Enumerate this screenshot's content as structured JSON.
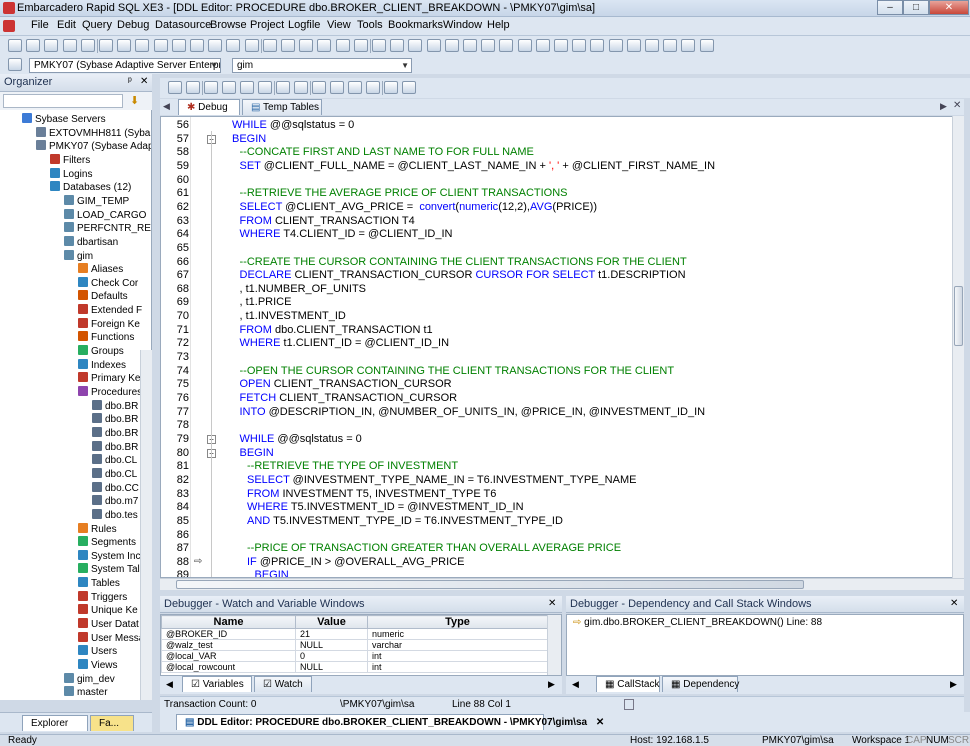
{
  "window": {
    "title": "Embarcadero Rapid SQL XE3 - [DDL Editor: PROCEDURE dbo.BROKER_CLIENT_BREAKDOWN - \\PMKY07\\gim\\sa]"
  },
  "menu": [
    "File",
    "Edit",
    "Query",
    "Debug",
    "Datasource",
    "Browse",
    "Project",
    "Logfile",
    "View",
    "Tools",
    "Bookmarks",
    "Window",
    "Help"
  ],
  "datasource_bar": {
    "server": "PMKY07 (Sybase Adaptive Server Enterpris",
    "database": "gim"
  },
  "organizer": {
    "title": "Organizer",
    "pin": "ᵖ",
    "items": [
      {
        "label": "Sybase Servers",
        "indent": 1,
        "color": "#3d7bd6"
      },
      {
        "label": "EXTOVMHH811 (Syba",
        "indent": 2,
        "color": "#6a7f99"
      },
      {
        "label": "PMKY07 (Sybase Adap",
        "indent": 2,
        "color": "#6a7f99"
      },
      {
        "label": "Filters",
        "indent": 3,
        "color": "#c0392b"
      },
      {
        "label": "Logins",
        "indent": 3,
        "color": "#2e86c1"
      },
      {
        "label": "Databases (12)",
        "indent": 3,
        "color": "#2e86c1"
      },
      {
        "label": "GIM_TEMP",
        "indent": 4,
        "color": "#5d8aa8"
      },
      {
        "label": "LOAD_CARGO",
        "indent": 4,
        "color": "#5d8aa8"
      },
      {
        "label": "PERFCNTR_RE",
        "indent": 4,
        "color": "#5d8aa8"
      },
      {
        "label": "dbartisan",
        "indent": 4,
        "color": "#5d8aa8"
      },
      {
        "label": "gim",
        "indent": 4,
        "color": "#5d8aa8"
      },
      {
        "label": "Aliases",
        "indent": 5,
        "color": "#e67e22"
      },
      {
        "label": "Check Cor",
        "indent": 5,
        "color": "#2e86c1"
      },
      {
        "label": "Defaults",
        "indent": 5,
        "color": "#d35400"
      },
      {
        "label": "Extended F",
        "indent": 5,
        "color": "#c0392b"
      },
      {
        "label": "Foreign Ke",
        "indent": 5,
        "color": "#c0392b"
      },
      {
        "label": "Functions",
        "indent": 5,
        "color": "#d35400"
      },
      {
        "label": "Groups",
        "indent": 5,
        "color": "#27ae60"
      },
      {
        "label": "Indexes",
        "indent": 5,
        "color": "#2e86c1"
      },
      {
        "label": "Primary Ke",
        "indent": 5,
        "color": "#c0392b"
      },
      {
        "label": "Procedures",
        "indent": 5,
        "color": "#8e44ad"
      },
      {
        "label": "dbo.BR",
        "indent": 6,
        "color": "#5b6f88"
      },
      {
        "label": "dbo.BR",
        "indent": 6,
        "color": "#5b6f88"
      },
      {
        "label": "dbo.BR",
        "indent": 6,
        "color": "#5b6f88"
      },
      {
        "label": "dbo.BR",
        "indent": 6,
        "color": "#5b6f88"
      },
      {
        "label": "dbo.CL",
        "indent": 6,
        "color": "#5b6f88"
      },
      {
        "label": "dbo.CL",
        "indent": 6,
        "color": "#5b6f88"
      },
      {
        "label": "dbo.CC",
        "indent": 6,
        "color": "#5b6f88"
      },
      {
        "label": "dbo.m7",
        "indent": 6,
        "color": "#5b6f88"
      },
      {
        "label": "dbo.tes",
        "indent": 6,
        "color": "#5b6f88"
      },
      {
        "label": "Rules",
        "indent": 5,
        "color": "#e67e22"
      },
      {
        "label": "Segments",
        "indent": 5,
        "color": "#27ae60"
      },
      {
        "label": "System Inc",
        "indent": 5,
        "color": "#2e86c1"
      },
      {
        "label": "System Tal",
        "indent": 5,
        "color": "#27ae60"
      },
      {
        "label": "Tables",
        "indent": 5,
        "color": "#2e86c1"
      },
      {
        "label": "Triggers",
        "indent": 5,
        "color": "#c0392b"
      },
      {
        "label": "Unique Ke",
        "indent": 5,
        "color": "#c0392b"
      },
      {
        "label": "User Datat",
        "indent": 5,
        "color": "#c0392b"
      },
      {
        "label": "User Messa",
        "indent": 5,
        "color": "#c0392b"
      },
      {
        "label": "Users",
        "indent": 5,
        "color": "#2e86c1"
      },
      {
        "label": "Views",
        "indent": 5,
        "color": "#2e86c1"
      },
      {
        "label": "gim_dev",
        "indent": 4,
        "color": "#5d8aa8"
      },
      {
        "label": "master",
        "indent": 4,
        "color": "#5d8aa8"
      }
    ],
    "bottom_tabs": [
      "Explorer",
      "Fa..."
    ]
  },
  "editor_tabs": [
    "Debug",
    "Temp Tables"
  ],
  "code_lines": [
    {
      "n": "56",
      "i": 4,
      "t": [
        [
          "kw",
          "WHILE "
        ],
        [
          "",
          "@@sqlstatus = 0"
        ]
      ]
    },
    {
      "n": "57",
      "i": 4,
      "t": [
        [
          "kw",
          "BEGIN"
        ]
      ]
    },
    {
      "n": "58",
      "i": 6,
      "t": [
        [
          "cm",
          "--CONCATE FIRST AND LAST NAME TO FOR FULL NAME"
        ]
      ]
    },
    {
      "n": "59",
      "i": 6,
      "t": [
        [
          "kw",
          "SET "
        ],
        [
          "",
          "@CLIENT_FULL_NAME = @CLIENT_LAST_NAME_IN + "
        ],
        [
          "st",
          "', '"
        ],
        [
          "",
          " + @CLIENT_FIRST_NAME_IN"
        ]
      ]
    },
    {
      "n": "60",
      "i": 0,
      "t": []
    },
    {
      "n": "61",
      "i": 6,
      "t": [
        [
          "cm",
          "--RETRIEVE THE AVERAGE PRICE OF CLIENT TRANSACTIONS"
        ]
      ]
    },
    {
      "n": "62",
      "i": 6,
      "t": [
        [
          "kw",
          "SELECT "
        ],
        [
          "",
          "@CLIENT_AVG_PRICE =  "
        ],
        [
          "fn",
          "convert"
        ],
        [
          "",
          "("
        ],
        [
          "fn",
          "numeric"
        ],
        [
          "",
          "(12,2),"
        ],
        [
          "fn",
          "AVG"
        ],
        [
          "",
          "(PRICE))"
        ]
      ]
    },
    {
      "n": "63",
      "i": 6,
      "t": [
        [
          "kw",
          "FROM "
        ],
        [
          "",
          "CLIENT_TRANSACTION T4"
        ]
      ]
    },
    {
      "n": "64",
      "i": 6,
      "t": [
        [
          "kw",
          "WHERE "
        ],
        [
          "",
          "T4.CLIENT_ID = @CLIENT_ID_IN"
        ]
      ]
    },
    {
      "n": "65",
      "i": 0,
      "t": []
    },
    {
      "n": "66",
      "i": 6,
      "t": [
        [
          "cm",
          "--CREATE THE CURSOR CONTAINING THE CLIENT TRANSACTIONS FOR THE CLIENT"
        ]
      ]
    },
    {
      "n": "67",
      "i": 6,
      "t": [
        [
          "kw",
          "DECLARE "
        ],
        [
          "",
          "CLIENT_TRANSACTION_CURSOR "
        ],
        [
          "kw",
          "CURSOR FOR SELECT "
        ],
        [
          "",
          "t1.DESCRIPTION"
        ]
      ]
    },
    {
      "n": "68",
      "i": 6,
      "t": [
        [
          "",
          ", t1.NUMBER_OF_UNITS"
        ]
      ]
    },
    {
      "n": "69",
      "i": 6,
      "t": [
        [
          "",
          ", t1.PRICE"
        ]
      ]
    },
    {
      "n": "70",
      "i": 6,
      "t": [
        [
          "",
          ", t1.INVESTMENT_ID"
        ]
      ]
    },
    {
      "n": "71",
      "i": 6,
      "t": [
        [
          "kw",
          "FROM "
        ],
        [
          "",
          "dbo.CLIENT_TRANSACTION t1"
        ]
      ]
    },
    {
      "n": "72",
      "i": 6,
      "t": [
        [
          "kw",
          "WHERE "
        ],
        [
          "",
          "t1.CLIENT_ID = @CLIENT_ID_IN"
        ]
      ]
    },
    {
      "n": "73",
      "i": 0,
      "t": []
    },
    {
      "n": "74",
      "i": 6,
      "t": [
        [
          "cm",
          "--OPEN THE CURSOR CONTAINING THE CLIENT TRANSACTIONS FOR THE CLIENT"
        ]
      ]
    },
    {
      "n": "75",
      "i": 6,
      "t": [
        [
          "kw",
          "OPEN "
        ],
        [
          "",
          "CLIENT_TRANSACTION_CURSOR"
        ]
      ]
    },
    {
      "n": "76",
      "i": 6,
      "t": [
        [
          "kw",
          "FETCH "
        ],
        [
          "",
          "CLIENT_TRANSACTION_CURSOR"
        ]
      ]
    },
    {
      "n": "77",
      "i": 6,
      "t": [
        [
          "kw",
          "INTO "
        ],
        [
          "",
          "@DESCRIPTION_IN, @NUMBER_OF_UNITS_IN, @PRICE_IN, @INVESTMENT_ID_IN"
        ]
      ]
    },
    {
      "n": "78",
      "i": 0,
      "t": []
    },
    {
      "n": "79",
      "i": 6,
      "t": [
        [
          "kw",
          "WHILE "
        ],
        [
          "",
          "@@sqlstatus = 0"
        ]
      ]
    },
    {
      "n": "80",
      "i": 6,
      "t": [
        [
          "kw",
          "BEGIN"
        ]
      ]
    },
    {
      "n": "81",
      "i": 8,
      "t": [
        [
          "cm",
          "--RETRIEVE THE TYPE OF INVESTMENT"
        ]
      ]
    },
    {
      "n": "82",
      "i": 8,
      "t": [
        [
          "kw",
          "SELECT "
        ],
        [
          "",
          "@INVESTMENT_TYPE_NAME_IN = T6.INVESTMENT_TYPE_NAME"
        ]
      ]
    },
    {
      "n": "83",
      "i": 8,
      "t": [
        [
          "kw",
          "FROM "
        ],
        [
          "",
          "INVESTMENT T5, INVESTMENT_TYPE T6"
        ]
      ]
    },
    {
      "n": "84",
      "i": 8,
      "t": [
        [
          "kw",
          "WHERE "
        ],
        [
          "",
          "T5.INVESTMENT_ID = @INVESTMENT_ID_IN"
        ]
      ]
    },
    {
      "n": "85",
      "i": 8,
      "t": [
        [
          "kw",
          "AND "
        ],
        [
          "",
          "T5.INVESTMENT_TYPE_ID = T6.INVESTMENT_TYPE_ID"
        ]
      ]
    },
    {
      "n": "86",
      "i": 0,
      "t": []
    },
    {
      "n": "87",
      "i": 8,
      "t": [
        [
          "cm",
          "--PRICE OF TRANSACTION GREATER THAN OVERALL AVERAGE PRICE"
        ]
      ]
    },
    {
      "n": "88",
      "i": 8,
      "t": [
        [
          "kw",
          "IF "
        ],
        [
          "",
          "@PRICE_IN > @OVERALL_AVG_PRICE"
        ]
      ]
    },
    {
      "n": "89",
      "i": 10,
      "t": [
        [
          "kw",
          "BEGIN"
        ]
      ]
    }
  ],
  "watch_panel": {
    "title": "Debugger - Watch and Variable Windows",
    "columns": [
      "Name",
      "Value",
      "Type"
    ],
    "rows": [
      [
        "@BROKER_ID",
        "21",
        "numeric"
      ],
      [
        "@walz_test",
        "NULL",
        "varchar"
      ],
      [
        "@local_VAR",
        "0",
        "int"
      ],
      [
        "@local_rowcount",
        "NULL",
        "int"
      ]
    ],
    "tabs": [
      "Variables",
      "Watch"
    ]
  },
  "callstack_panel": {
    "title": "Debugger - Dependency and Call Stack Windows",
    "entry": "gim.dbo.BROKER_CLIENT_BREAKDOWN() Line: 88",
    "tabs": [
      "CallStack",
      "Dependency"
    ]
  },
  "editor_status": {
    "transaction_count": "Transaction Count: 0",
    "user": "\\PMKY07\\gim\\sa",
    "position": "Line 88 Col 1"
  },
  "document_tab": "DDL Editor: PROCEDURE dbo.BROKER_CLIENT_BREAKDOWN - \\PMKY07\\gim\\sa",
  "status_bar": {
    "ready": "Ready",
    "host": "Host: 192.168.1.5",
    "user": "PMKY07\\gim\\sa",
    "workspace": "Workspace 1",
    "caps": "CAP",
    "num": "NUM",
    "scrl": "SCRL"
  }
}
